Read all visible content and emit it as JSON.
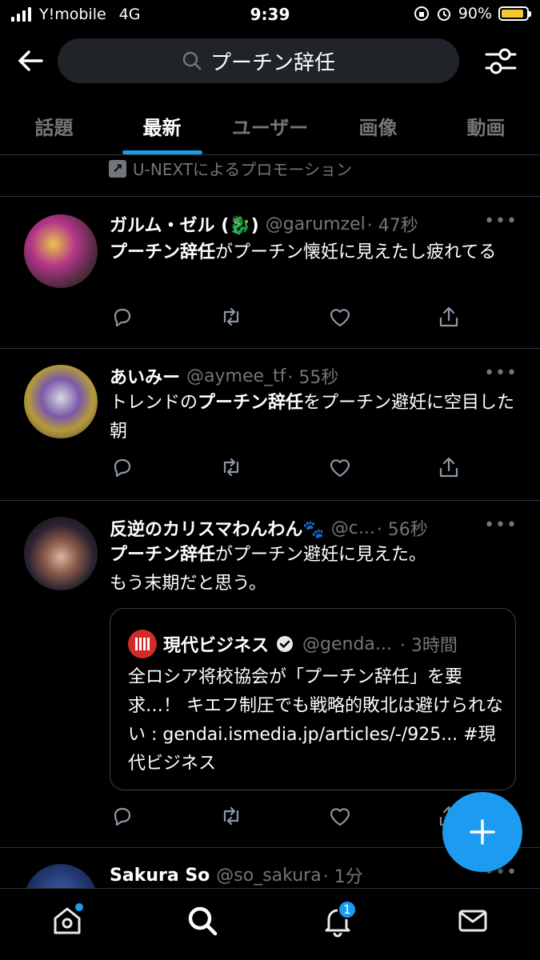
{
  "status_bar": {
    "carrier": "Y!mobile",
    "network": "4G",
    "time": "9:39",
    "battery_percent": "90%",
    "battery_level": 0.9
  },
  "header": {
    "search_query": "プーチン辞任",
    "back_icon": "back-arrow-icon",
    "filter_icon": "filter-sliders-icon"
  },
  "tabs": [
    {
      "label": "話題",
      "active": false
    },
    {
      "label": "最新",
      "active": true
    },
    {
      "label": "ユーザー",
      "active": false
    },
    {
      "label": "画像",
      "active": false
    },
    {
      "label": "動画",
      "active": false
    }
  ],
  "promo": {
    "text": "U-NEXTによるプロモーション"
  },
  "tweets": [
    {
      "name": "ガルム・ゼル (🐉)",
      "handle": "@garumzel",
      "time": "· 47秒",
      "highlight": "プーチン辞任",
      "text_after": "がプーチン懐妊に見えたし疲れてる"
    },
    {
      "name": "あいみー",
      "handle": "@aymee_tf",
      "time": "· 55秒",
      "text_before": "トレンドの",
      "highlight": "プーチン辞任",
      "text_after": "をプーチン避妊に空目した朝"
    },
    {
      "name": "反逆のカリスマわんわん🐾",
      "handle": "@c...",
      "time": "· 56秒",
      "highlight": "プーチン辞任",
      "text_after": "がプーチン避妊に見えた。",
      "text_line2": "もう末期だと思う。",
      "quote": {
        "name": "現代ビジネス",
        "handle": "@genda...",
        "time": "· 3時間",
        "text": "全ロシア将校協会が「プーチン辞任」を要求…！ キエフ制圧でも戦略的敗北は避けられない : gendai.ismedia.jp/articles/-/925... #現代ビジネス"
      }
    },
    {
      "name": "Sakura So",
      "handle": "@so_sakura",
      "time": "· 1分"
    }
  ],
  "bottom_nav": {
    "home_icon": "home-icon",
    "search_icon": "search-icon",
    "notifications_icon": "bell-icon",
    "notifications_count": "1",
    "messages_icon": "mail-icon"
  },
  "colors": {
    "accent": "#1d9bf0",
    "background": "#000000",
    "muted": "#71767b"
  }
}
